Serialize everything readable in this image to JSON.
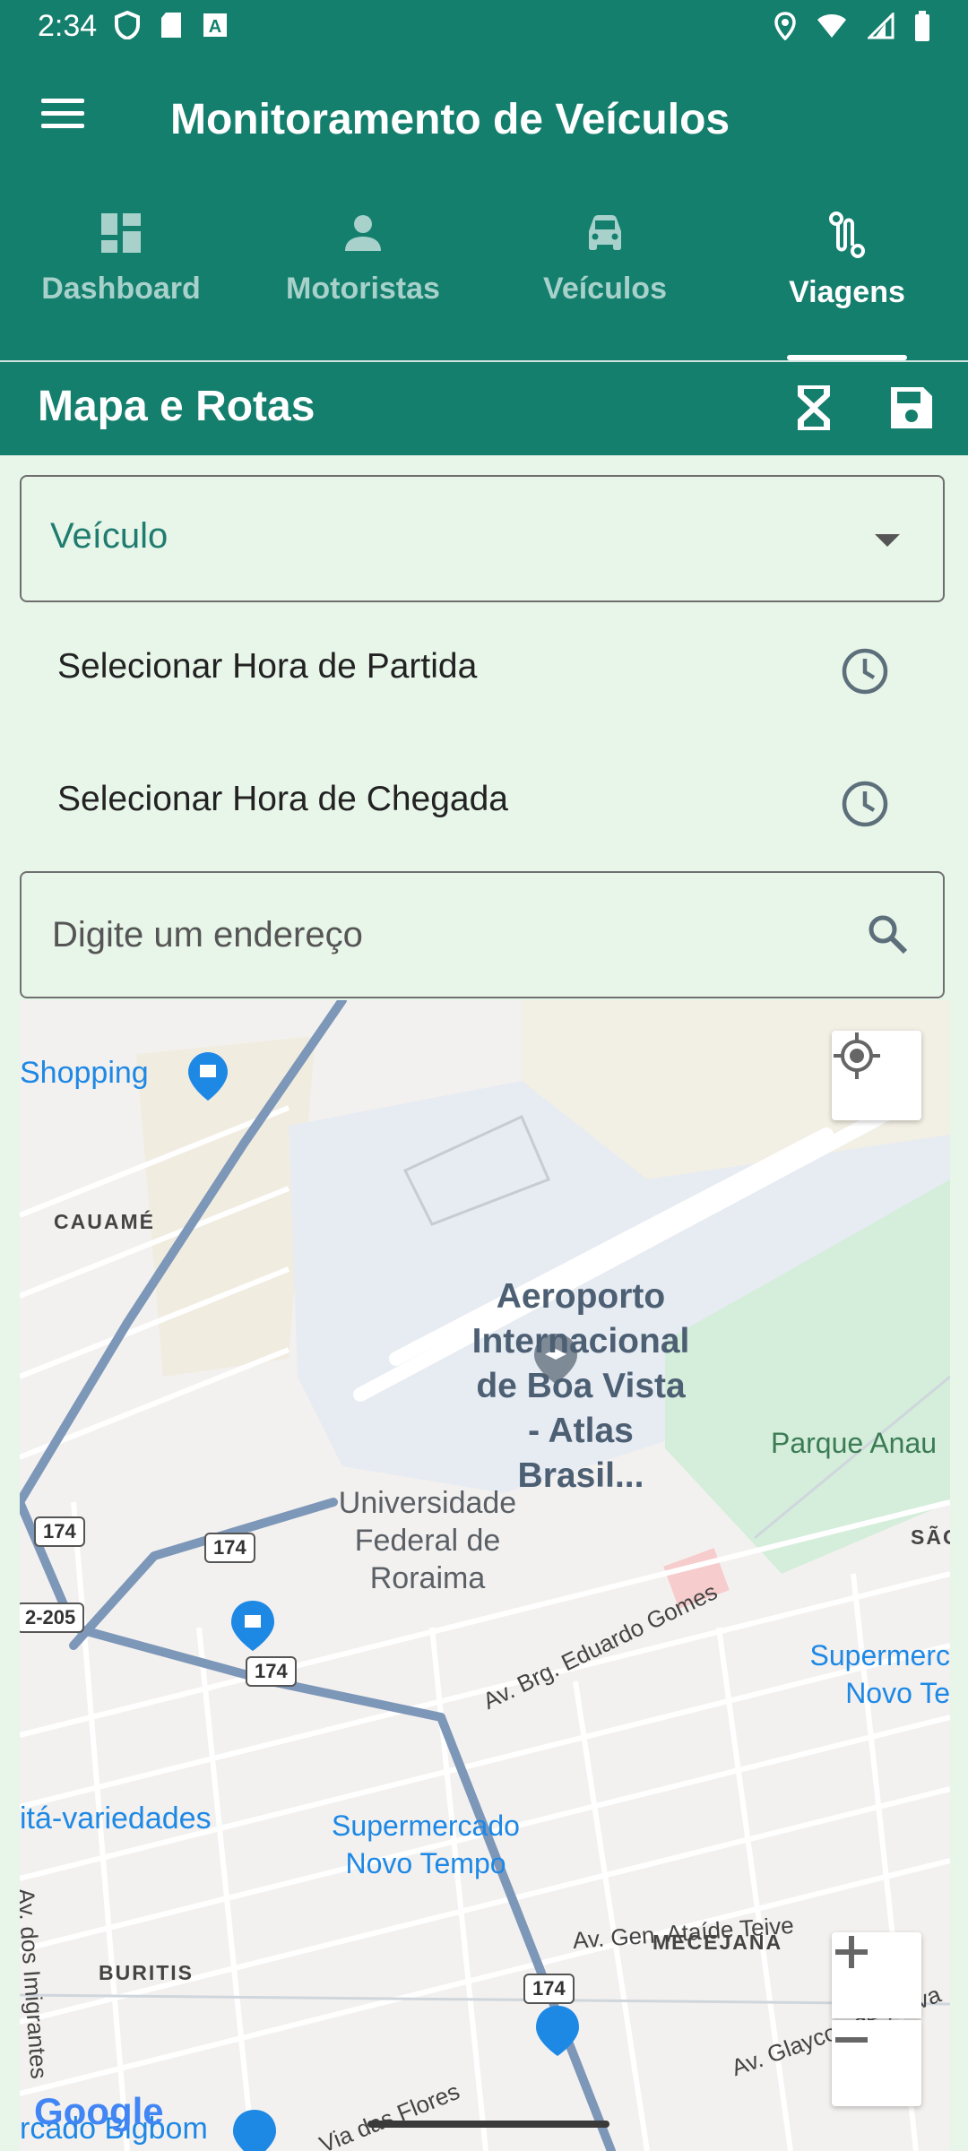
{
  "status_bar": {
    "time": "2:34",
    "left_icons": [
      "shield-icon",
      "sd-card-icon",
      "font-a-icon"
    ],
    "right_icons": [
      "location-icon",
      "wifi-icon",
      "signal-icon",
      "battery-icon"
    ]
  },
  "app_bar": {
    "title": "Monitoramento de Veículos",
    "menu_icon": "menu-icon"
  },
  "tabs": [
    {
      "label": "Dashboard",
      "icon": "dashboard-icon",
      "active": false
    },
    {
      "label": "Motoristas",
      "icon": "person-icon",
      "active": false
    },
    {
      "label": "Veículos",
      "icon": "car-icon",
      "active": false
    },
    {
      "label": "Viagens",
      "icon": "route-icon",
      "active": true
    }
  ],
  "section": {
    "title": "Mapa e Rotas",
    "actions": [
      "hourglass-icon",
      "save-icon"
    ]
  },
  "form": {
    "vehicle_label": "Veículo",
    "departure_label": "Selecionar Hora de Partida",
    "arrival_label": "Selecionar Hora de Chegada",
    "address_placeholder": "Digite um endereço"
  },
  "map": {
    "labels": {
      "shopping": "Shopping",
      "cauame": "CAUAMÉ",
      "airport_1": "Aeroporto",
      "airport_2": "Internacional",
      "airport_3": "de Boa Vista",
      "airport_4": "- Atlas Brasil...",
      "park": "Parque Anau",
      "university_1": "Universidade",
      "university_2": "Federal de",
      "university_3": "Roraima",
      "sao": "SÃO",
      "super_right_1": "Supermerc",
      "super_right_2": "Novo Te",
      "variedades": "itá-variedades",
      "super_1": "Supermercado",
      "super_2": "Novo Tempo",
      "mecejana": "MECEJANA",
      "buritis": "BURITIS",
      "av_brg": "Av. Brg. Eduardo Gomes",
      "av_gen": "Av. Gen. Ataíde Teive",
      "av_glaycon": "Av. Glaycon de Paiva",
      "av_imigrantes": "Av. dos Imigrantes",
      "via_flores": "Via das Flores",
      "bigbom": "rcado Bigbom",
      "br_205": "2-205",
      "google": "Google"
    },
    "route_shields": [
      "174",
      "174",
      "174",
      "174"
    ],
    "controls": [
      "my-location-icon",
      "zoom-in-icon",
      "zoom-out-icon"
    ]
  },
  "colors": {
    "primary": "#157f6e",
    "background": "#e8f5e9"
  }
}
